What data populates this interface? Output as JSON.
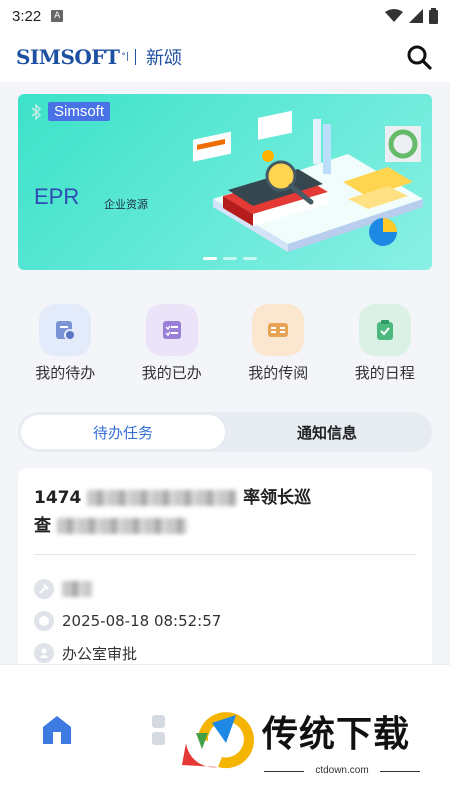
{
  "status_bar": {
    "time": "3:22",
    "notification_icon": "A"
  },
  "header": {
    "logo_text": "SIMSOFT",
    "logo_mark": "°|",
    "logo_cn": "新颂"
  },
  "banner": {
    "badge": "Simsoft",
    "title": "EPR",
    "subtitle": "企业资源"
  },
  "quick_menu": [
    {
      "label": "我的待办",
      "icon": "todo-icon",
      "color": "#e3ebfb",
      "fg": "#7b93d6"
    },
    {
      "label": "我的已办",
      "icon": "done-list-icon",
      "color": "#ebe3f8",
      "fg": "#9a7fd6"
    },
    {
      "label": "我的传阅",
      "icon": "circulate-icon",
      "color": "#fbe7d0",
      "fg": "#e8a455"
    },
    {
      "label": "我的日程",
      "icon": "schedule-icon",
      "color": "#dcf1e5",
      "fg": "#4cba7f"
    }
  ],
  "tabs": [
    {
      "label": "待办任务",
      "active": true
    },
    {
      "label": "通知信息",
      "active": false
    }
  ],
  "task": {
    "title_prefix": "1474",
    "title_mid": "率领长巡",
    "title_line2_prefix": "查",
    "datetime": "2025-08-18 08:52:57",
    "department": "办公室审批"
  },
  "watermark": {
    "text": "传统下载",
    "url": "ctdown.com"
  },
  "colors": {
    "accent": "#3670d9",
    "brand": "#1d4fa3"
  }
}
